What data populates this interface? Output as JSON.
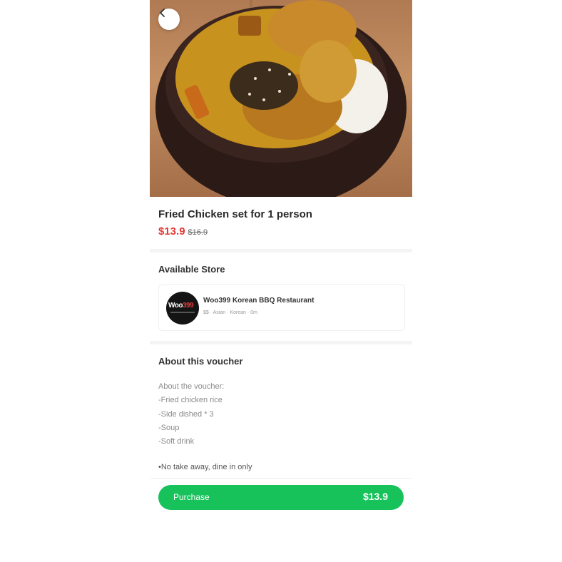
{
  "product": {
    "title": "Fried Chicken set for 1 person",
    "price": "$13.9",
    "original_price": "$16.9",
    "image_icon": "food-photo"
  },
  "store_section": {
    "heading": "Available Store",
    "store": {
      "logo_text_white": "Woo",
      "logo_text_red": "399",
      "name": "Woo399 Korean BBQ Restaurant",
      "meta": "$$ · Asian · Korean · 0m"
    }
  },
  "about_section": {
    "heading": "About this voucher",
    "lines": [
      "About the voucher:",
      "-Fried chicken rice",
      "-Side dished * 3",
      "-Soup",
      "-Soft drink",
      ""
    ],
    "note": "•No take away, dine in only"
  },
  "footer": {
    "purchase_label": "Purchase",
    "purchase_price": "$13.9"
  },
  "colors": {
    "accent_green": "#17c25b",
    "price_red": "#e53935"
  }
}
